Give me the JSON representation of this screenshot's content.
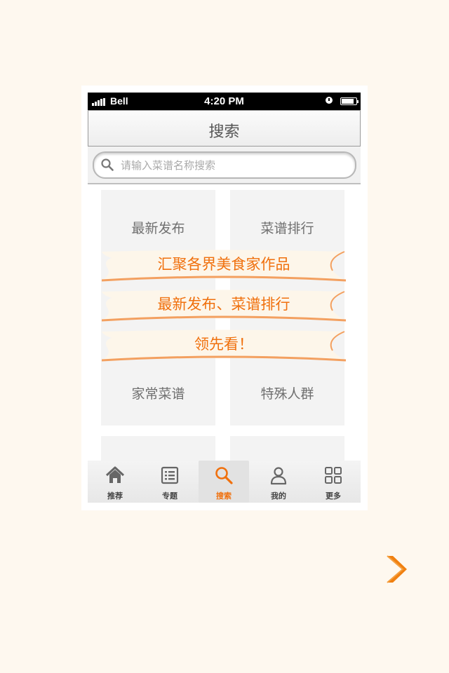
{
  "statusbar": {
    "carrier": "Bell",
    "time": "4:20 PM"
  },
  "header": {
    "title": "搜索"
  },
  "search": {
    "placeholder": "请输入菜谱名称搜索"
  },
  "tiles": [
    {
      "label": "最新发布"
    },
    {
      "label": "菜谱排行"
    },
    {
      "label": "家常菜谱"
    },
    {
      "label": "特殊人群"
    }
  ],
  "ribbons": [
    {
      "text": "汇聚各界美食家作品"
    },
    {
      "text": "最新发布、菜谱排行"
    },
    {
      "text": "领先看！"
    }
  ],
  "tabbar": {
    "active": 2,
    "items": [
      {
        "label": "推荐",
        "icon": "home-icon"
      },
      {
        "label": "专题",
        "icon": "list-icon"
      },
      {
        "label": "搜索",
        "icon": "search-icon"
      },
      {
        "label": "我的",
        "icon": "user-icon"
      },
      {
        "label": "更多",
        "icon": "grid-icon"
      }
    ]
  },
  "colors": {
    "accent": "#f0700d",
    "ribbon_edge": "#f3a060",
    "page_bg": "#fef8ef"
  }
}
